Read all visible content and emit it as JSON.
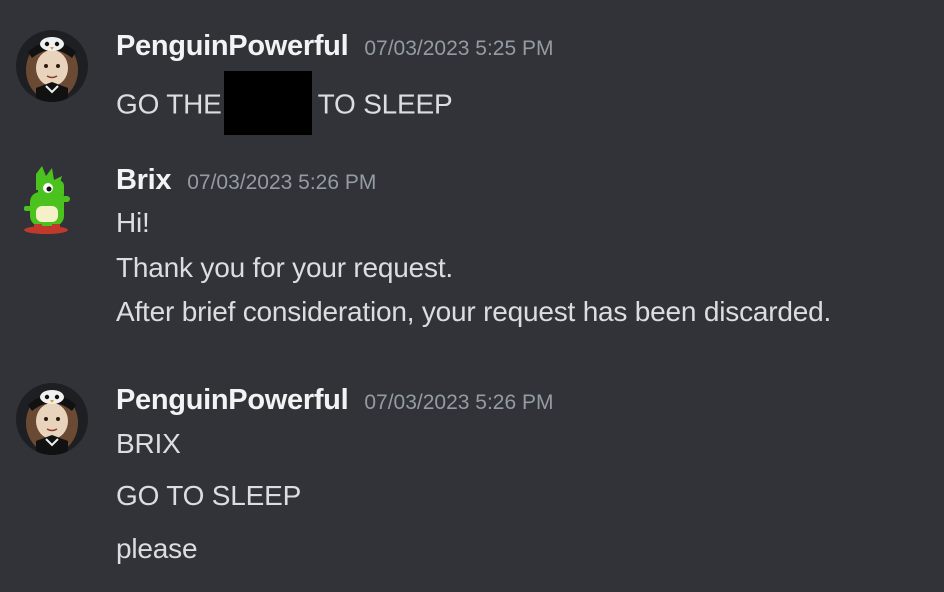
{
  "messages": [
    {
      "author": "PenguinPowerful",
      "timestamp": "07/03/2023 5:25 PM",
      "avatar_icon": "penguin-avatar-icon",
      "lines": [
        {
          "before": "GO THE",
          "after": "TO SLEEP",
          "redacted": true
        }
      ]
    },
    {
      "author": "Brix",
      "timestamp": "07/03/2023 5:26 PM",
      "avatar_icon": "green-dragon-avatar-icon",
      "lines": [
        "Hi!",
        "Thank you for your request.",
        "After brief consideration, your request has been discarded."
      ]
    },
    {
      "author": "PenguinPowerful",
      "timestamp": "07/03/2023 5:26 PM",
      "avatar_icon": "penguin-avatar-icon",
      "lines": [
        "BRIX",
        "GO TO SLEEP",
        "please"
      ]
    }
  ],
  "colors": {
    "background": "#313338",
    "username": "#f2f3f5",
    "text": "#dbdee1",
    "timestamp": "#949ba4"
  }
}
